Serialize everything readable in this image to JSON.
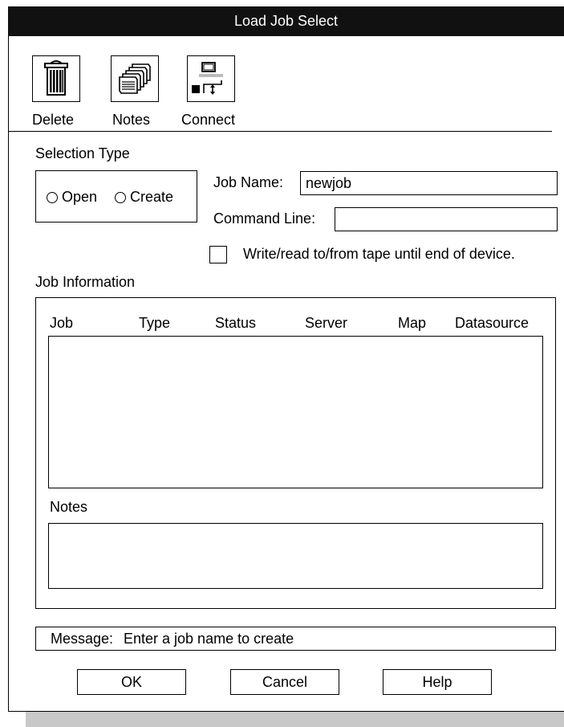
{
  "window": {
    "title": "Load Job Select"
  },
  "toolbar": {
    "delete_label": "Delete",
    "notes_label": "Notes",
    "connect_label": "Connect"
  },
  "selection_type": {
    "heading": "Selection Type",
    "open_label": "Open",
    "create_label": "Create"
  },
  "form": {
    "job_name_label": "Job Name:",
    "job_name_value": "newjob",
    "command_line_label": "Command Line:",
    "command_line_value": "",
    "tape_checkbox_label": "Write/read to/from tape until end of device."
  },
  "job_information": {
    "heading": "Job Information",
    "columns": [
      "Job",
      "Type",
      "Status",
      "Server",
      "Map",
      "Datasource"
    ],
    "rows": [],
    "notes_heading": "Notes",
    "notes_value": ""
  },
  "message": {
    "label": "Message:",
    "text": "Enter a job name to create"
  },
  "buttons": {
    "ok": "OK",
    "cancel": "Cancel",
    "help": "Help"
  }
}
